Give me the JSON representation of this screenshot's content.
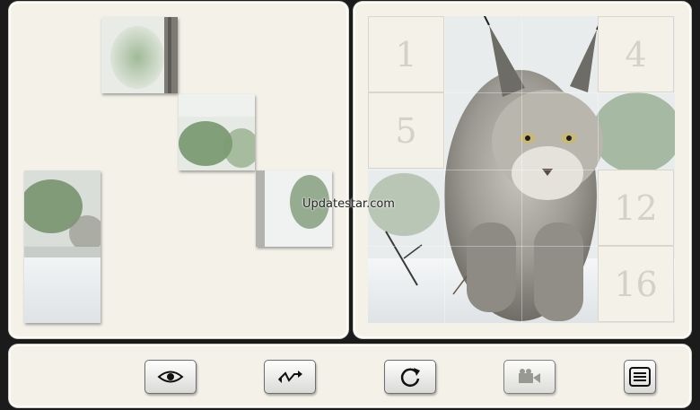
{
  "colors": {
    "background": "#1b1b1b",
    "panel": "#f3f1e8",
    "cell_border": "#d9d7cc",
    "cell_number": "#d4d2c6",
    "snow": "#eef0f2",
    "lynx_fur": "#9a9a93",
    "greenery": "#6f8f66"
  },
  "board": {
    "grid": "4x4",
    "empty_cells": [
      {
        "number": "1"
      },
      {
        "number": "4"
      },
      {
        "number": "5"
      },
      {
        "number": "12"
      },
      {
        "number": "16"
      }
    ]
  },
  "tray": {
    "loose_pieces": 5
  },
  "toolbar": {
    "buttons": [
      {
        "icon": "eye-icon"
      },
      {
        "icon": "swap-arrows-icon"
      },
      {
        "icon": "restart-icon"
      },
      {
        "icon": "video-camera-icon"
      },
      {
        "icon": "menu-icon"
      }
    ]
  },
  "watermark": "Updatestar.com"
}
